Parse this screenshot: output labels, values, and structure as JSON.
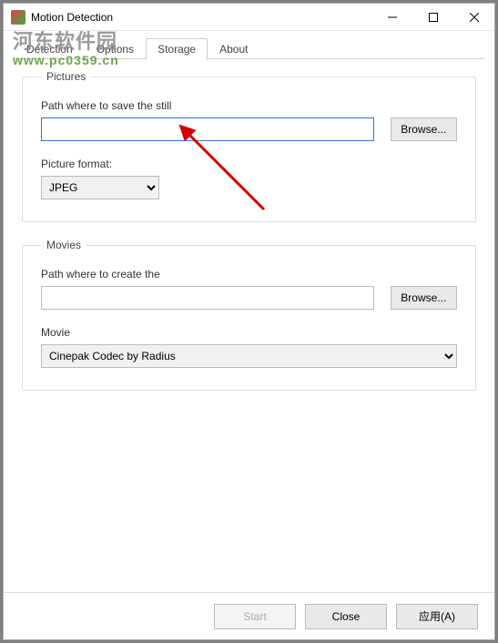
{
  "window": {
    "title": "Motion Detection"
  },
  "tabs": {
    "items": [
      "Detection",
      "Options",
      "Storage",
      "About"
    ],
    "active": "Storage"
  },
  "pictures": {
    "legend": "Pictures",
    "path_label": "Path where to save the still",
    "path_value": "",
    "browse": "Browse...",
    "format_label": "Picture format:",
    "format_value": "JPEG"
  },
  "movies": {
    "legend": "Movies",
    "path_label": "Path where to create the",
    "path_value": "",
    "browse": "Browse...",
    "codec_label": "Movie",
    "codec_value": "Cinepak Codec by Radius"
  },
  "buttons": {
    "start": "Start",
    "close": "Close",
    "apply": "应用(A)"
  },
  "watermark": {
    "line1": "河东软件园",
    "line2": "www.pc0359.cn"
  }
}
